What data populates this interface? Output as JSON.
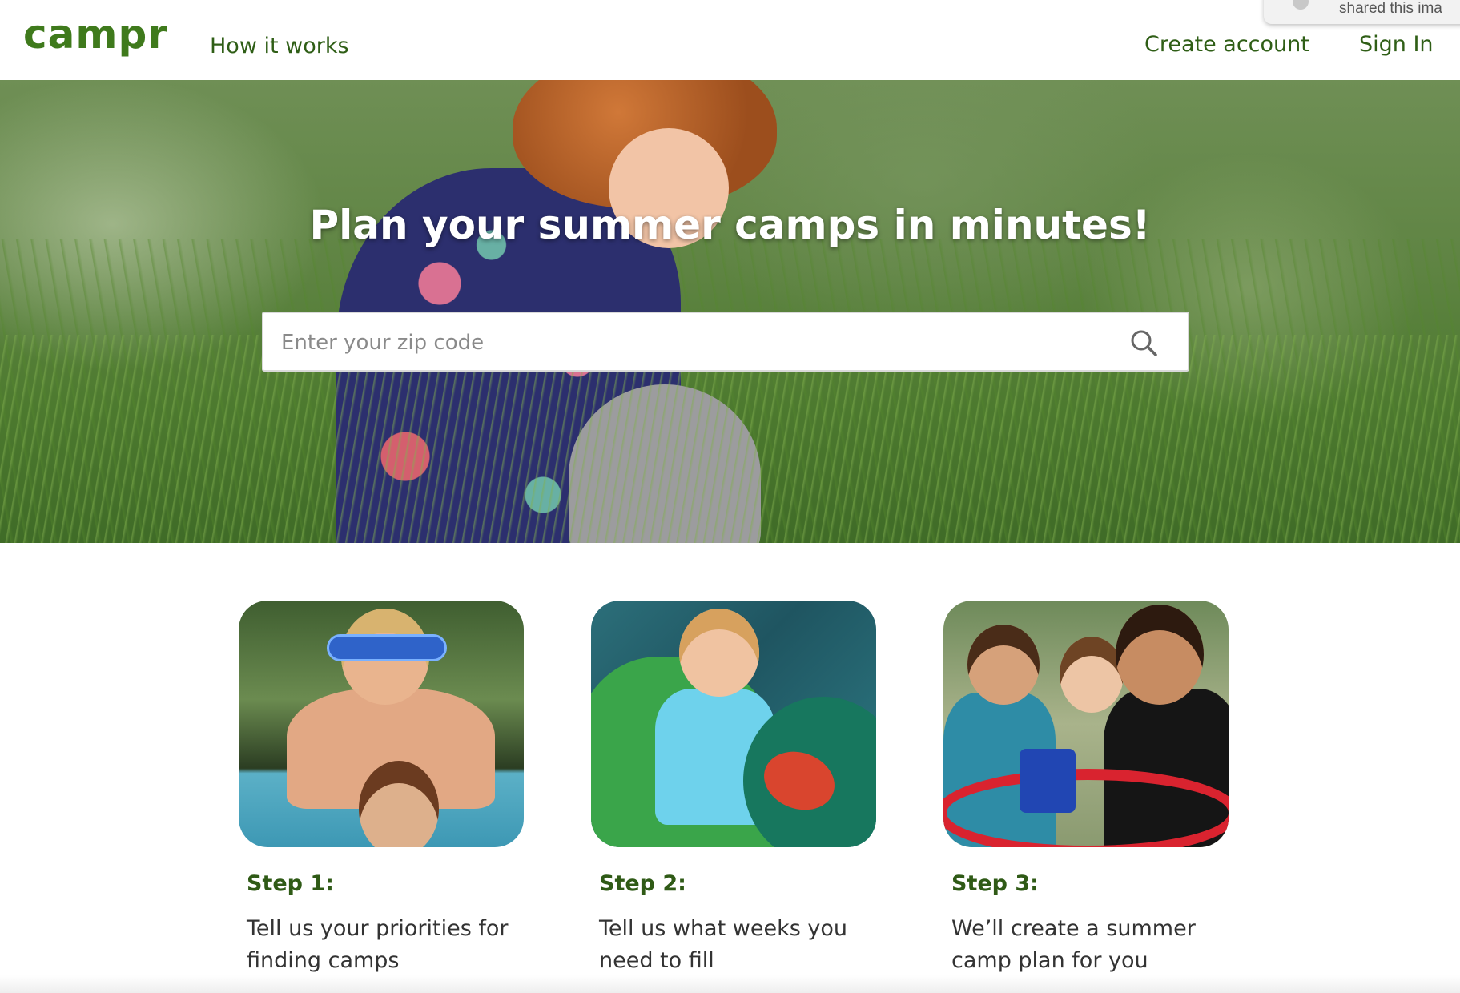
{
  "header": {
    "logo": "campr",
    "nav": {
      "how_it_works": "How it works",
      "create_account": "Create account",
      "sign_in": "Sign In"
    },
    "share_toast": "shared this ima"
  },
  "hero": {
    "title": "Plan your summer camps in minutes!",
    "search": {
      "placeholder": "Enter your zip code",
      "value": ""
    }
  },
  "steps": [
    {
      "label": "Step 1:",
      "text": "Tell us your priorities for finding camps"
    },
    {
      "label": "Step 2:",
      "text": "Tell us what weeks you need to fill"
    },
    {
      "label": "Step 3:",
      "text": "We’ll create a summer camp plan for you"
    }
  ],
  "colors": {
    "brand_green": "#3f7a1c",
    "nav_green": "#2f5e16",
    "step_green": "#2f5a16"
  },
  "icons": [
    "search-icon"
  ]
}
